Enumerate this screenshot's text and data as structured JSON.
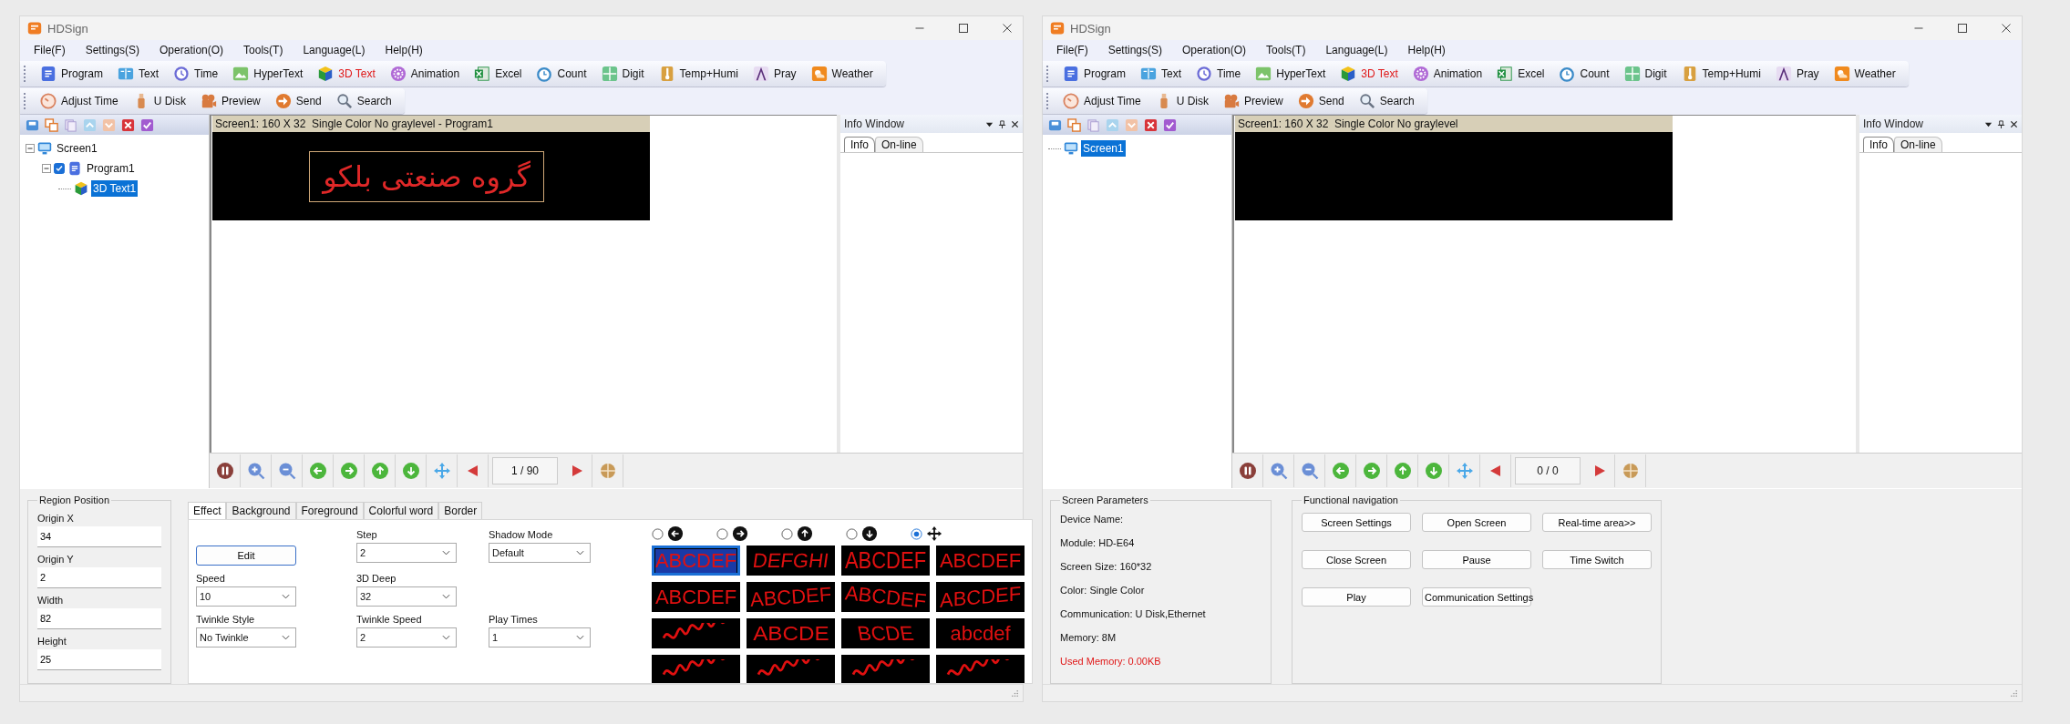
{
  "windows": [
    {
      "title": "HDSign",
      "menu": [
        "File(F)",
        "Settings(S)",
        "Operation(O)",
        "Tools(T)",
        "Language(L)",
        "Help(H)"
      ],
      "toolbar_main": [
        {
          "label": "Program",
          "selected": false
        },
        {
          "label": "Text",
          "selected": false
        },
        {
          "label": "Time",
          "selected": false
        },
        {
          "label": "HyperText",
          "selected": false
        },
        {
          "label": "3D Text",
          "selected": true
        },
        {
          "label": "Animation",
          "selected": false
        },
        {
          "label": "Excel",
          "selected": false
        },
        {
          "label": "Count",
          "selected": false
        },
        {
          "label": "Digit",
          "selected": false
        },
        {
          "label": "Temp+Humi",
          "selected": false
        },
        {
          "label": "Pray",
          "selected": false
        },
        {
          "label": "Weather",
          "selected": false
        }
      ],
      "toolbar_tools": [
        "Adjust Time",
        "U Disk",
        "Preview",
        "Send",
        "Search"
      ],
      "tree": [
        {
          "label": "Screen1",
          "kind": "screen",
          "selected": false,
          "expanded": true,
          "children": [
            {
              "label": "Program1",
              "kind": "program",
              "selected": false,
              "checked": true,
              "expanded": true,
              "children": [
                {
                  "label": "3D Text1",
                  "kind": "text3d",
                  "selected": true
                }
              ]
            }
          ]
        }
      ],
      "preview": {
        "header": "Screen1: 160 X 32  Single Color No graylevel - Program1",
        "led_text": "گروه صنعتی بلکو"
      },
      "info_window": {
        "title": "Info Window",
        "tabs": [
          {
            "label": "Info",
            "selected": true
          },
          {
            "label": "On-line",
            "selected": false
          }
        ]
      },
      "playback": {
        "counter": "1 / 90"
      },
      "bottom_panel": {
        "kind": "region_editor",
        "region_position": {
          "title": "Region Position",
          "fields": [
            {
              "label": "Origin X",
              "value": "34"
            },
            {
              "label": "Origin Y",
              "value": "2"
            },
            {
              "label": "Width",
              "value": "82"
            },
            {
              "label": "Height",
              "value": "25"
            }
          ]
        },
        "tabs": [
          {
            "label": "Effect",
            "selected": true
          },
          {
            "label": "Background",
            "selected": false
          },
          {
            "label": "Foreground",
            "selected": false
          },
          {
            "label": "Colorful word",
            "selected": false
          },
          {
            "label": "Border",
            "selected": false
          }
        ],
        "form_rows": [
          [
            {
              "kind": "button",
              "label": "Edit"
            },
            {
              "kind": "select",
              "label": "Step",
              "value": "2"
            },
            {
              "kind": "select",
              "label": "Shadow Mode",
              "value": "Default"
            }
          ],
          [
            {
              "kind": "select",
              "label": "Speed",
              "value": "10"
            },
            {
              "kind": "select",
              "label": "3D Deep",
              "value": "32"
            }
          ],
          [
            {
              "kind": "select",
              "label": "Twinkle Style",
              "value": "No Twinkle"
            },
            {
              "kind": "select",
              "label": "Twinkle Speed",
              "value": "2"
            },
            {
              "kind": "select",
              "label": "Play Times",
              "value": "1"
            }
          ]
        ],
        "directions": [
          {
            "selected": false
          },
          {
            "selected": false
          },
          {
            "selected": false
          },
          {
            "selected": false
          },
          {
            "selected": true
          }
        ],
        "effects": [
          {
            "text": "ABCDEF",
            "selected": true
          },
          {
            "text": "DEFGHI",
            "selected": false
          },
          {
            "text": "ABCDEF",
            "selected": false
          },
          {
            "text": "ABCDEF",
            "selected": false
          },
          {
            "text": "ABCDEF",
            "selected": false
          },
          {
            "text": "ABCDEF",
            "selected": false
          },
          {
            "text": "ABCDEF",
            "selected": false
          },
          {
            "text": "ABCDEF",
            "selected": false
          },
          {
            "selected": false
          },
          {
            "text": "ABCDE",
            "selected": false
          },
          {
            "text": "BCDE",
            "selected": false
          },
          {
            "text": "abcdef",
            "selected": false
          },
          {
            "selected": false
          },
          {
            "selected": false
          },
          {
            "selected": false
          },
          {
            "selected": false
          }
        ]
      }
    },
    {
      "title": "HDSign",
      "menu": [
        "File(F)",
        "Settings(S)",
        "Operation(O)",
        "Tools(T)",
        "Language(L)",
        "Help(H)"
      ],
      "toolbar_main": [
        {
          "label": "Program",
          "selected": false
        },
        {
          "label": "Text",
          "selected": false
        },
        {
          "label": "Time",
          "selected": false
        },
        {
          "label": "HyperText",
          "selected": false
        },
        {
          "label": "3D Text",
          "selected": true
        },
        {
          "label": "Animation",
          "selected": false
        },
        {
          "label": "Excel",
          "selected": false
        },
        {
          "label": "Count",
          "selected": false
        },
        {
          "label": "Digit",
          "selected": false
        },
        {
          "label": "Temp+Humi",
          "selected": false
        },
        {
          "label": "Pray",
          "selected": false
        },
        {
          "label": "Weather",
          "selected": false
        }
      ],
      "toolbar_tools": [
        "Adjust Time",
        "U Disk",
        "Preview",
        "Send",
        "Search"
      ],
      "tree": [
        {
          "label": "Screen1",
          "kind": "screen",
          "selected": true
        }
      ],
      "preview": {
        "header": "Screen1: 160 X 32  Single Color No graylevel"
      },
      "info_window": {
        "title": "Info Window",
        "tabs": [
          {
            "label": "Info",
            "selected": true
          },
          {
            "label": "On-line",
            "selected": false
          }
        ]
      },
      "playback": {
        "counter": "0 / 0"
      },
      "bottom_panel": {
        "kind": "screen_info",
        "screen_parameters": {
          "title": "Screen Parameters",
          "lines": [
            {
              "text": "Device Name:",
              "alert": false
            },
            {
              "text": "Module: HD-E64",
              "alert": false
            },
            {
              "text": "Screen Size: 160*32",
              "alert": false
            },
            {
              "text": "Color: Single Color",
              "alert": false
            },
            {
              "text": "Communication: U Disk,Ethernet",
              "alert": false
            },
            {
              "text": "Memory: 8M",
              "alert": false
            },
            {
              "text": "Used Memory: 0.00KB",
              "alert": true
            }
          ]
        },
        "functional_navigation": {
          "title": "Functional navigation",
          "buttons": [
            "Screen Settings",
            "Open Screen",
            "Real-time area>>",
            "Close Screen",
            "Pause",
            "Time Switch",
            "Play",
            "Communication Settings"
          ]
        }
      }
    }
  ]
}
